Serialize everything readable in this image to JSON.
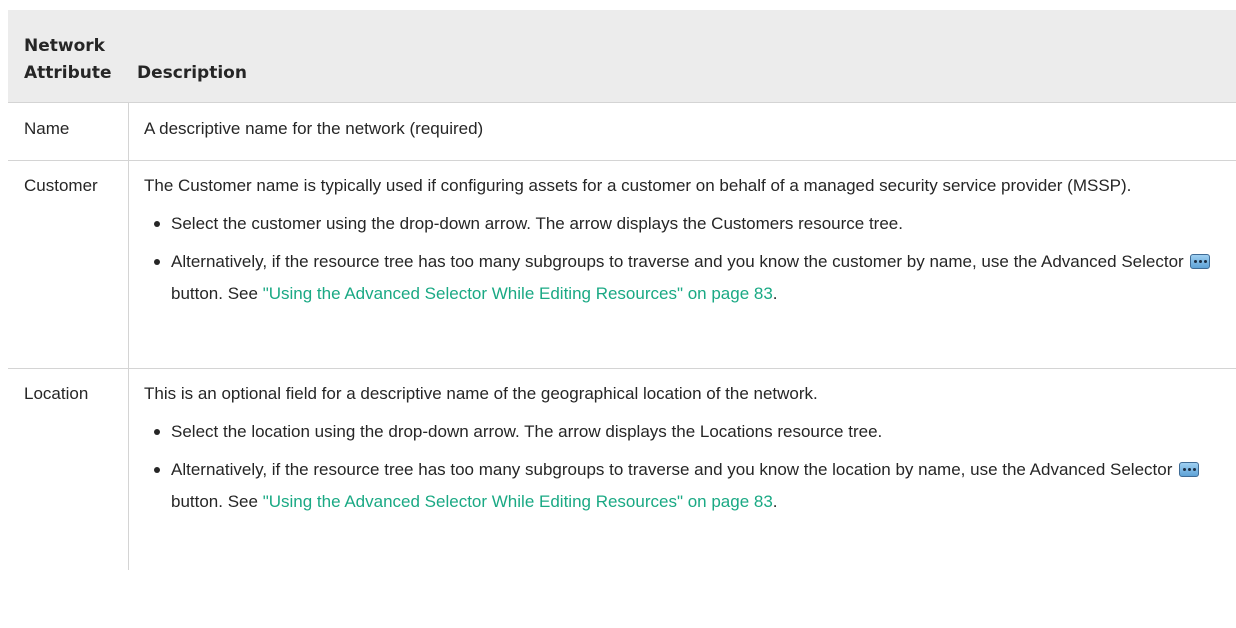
{
  "header": {
    "col1": "Network Attribute",
    "col2": "Description"
  },
  "rows": [
    {
      "attribute": "Name",
      "description": "A descriptive name for the network (required)"
    },
    {
      "attribute": "Customer",
      "description": "The Customer name is typically used if configuring assets for a customer on behalf of a managed security service provider (MSSP).",
      "bullet1": "Select the customer using the drop-down arrow. The arrow displays the Customers resource tree.",
      "bullet2_pre": "Alternatively, if the resource tree has too many subgroups to traverse and you know the customer by name, use the Advanced Selector",
      "bullet2_mid": "button. See",
      "link": "\"Using the Advanced Selector While Editing Resources\" on page 83",
      "bullet2_end": "."
    },
    {
      "attribute": "Location",
      "description": "This is an optional field for a descriptive name of the geographical location of the network.",
      "bullet1": "Select the location using the drop-down arrow. The arrow displays the Locations resource tree.",
      "bullet2_pre": "Alternatively, if the resource tree has too many subgroups to traverse and you know the location by name, use the Advanced Selector",
      "bullet2_mid": "button. See",
      "link": "\"Using the Advanced Selector While Editing Resources\" on page 83",
      "bullet2_end": "."
    }
  ],
  "icons": {
    "advanced_selector": "ellipsis-button-icon"
  },
  "colors": {
    "link": "#1aa984",
    "header_bg": "#ececec",
    "border": "#d4d4d4"
  }
}
